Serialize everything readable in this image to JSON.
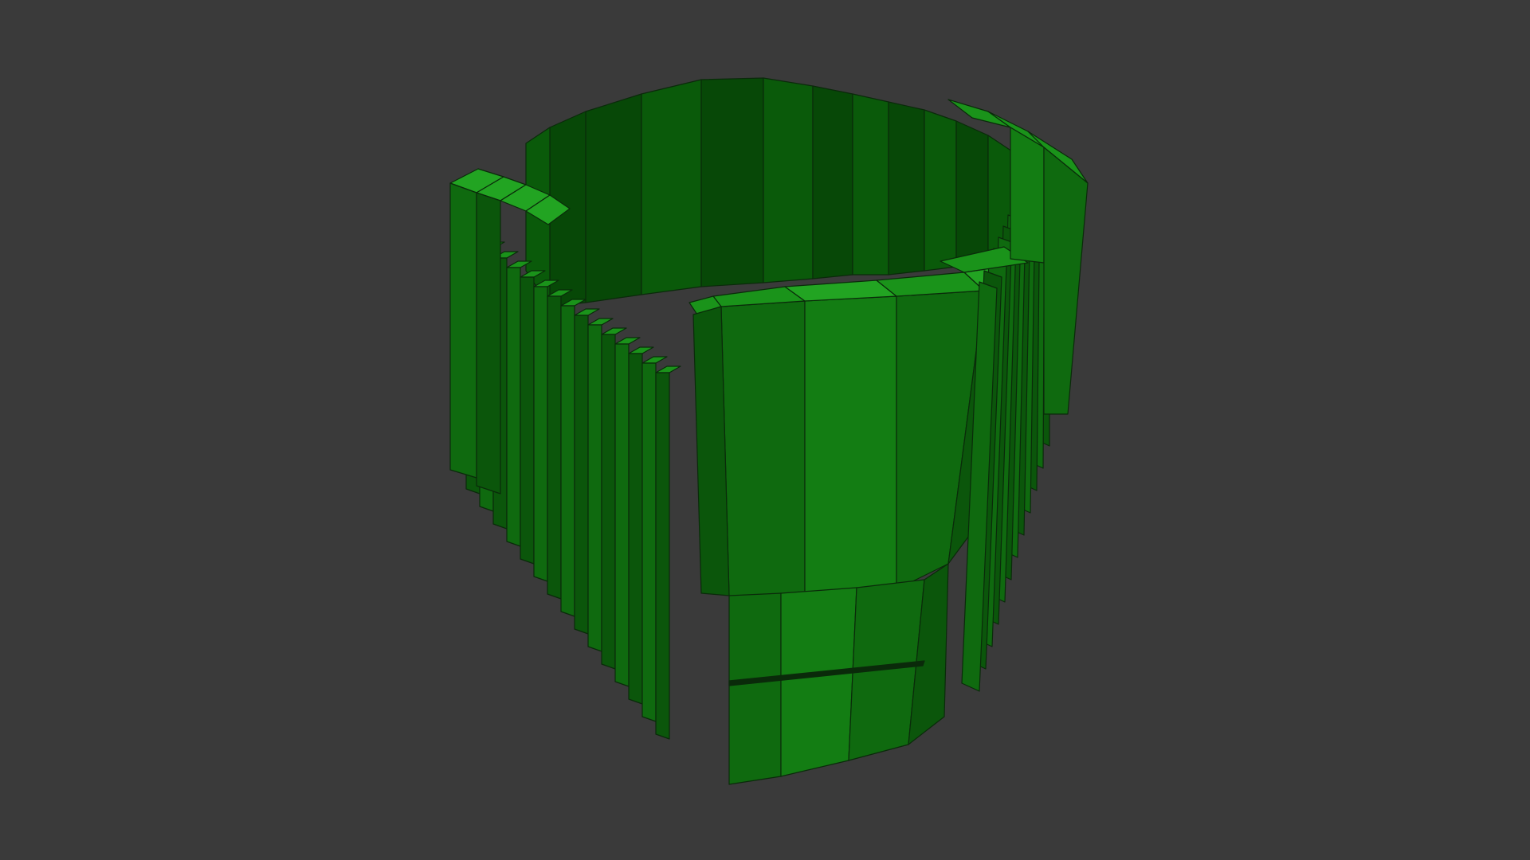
{
  "scene": {
    "background_color": "#3a3a3a",
    "object": "voxel-cup",
    "colors": {
      "outer_lit": "#137d13",
      "outer_mid": "#0f6a0f",
      "outer_dark": "#0b560b",
      "inner_wall": "#0a5a0a",
      "inner_dark": "#074807",
      "rim_top": "#1a931a",
      "rim_top_light": "#22a422",
      "edge": "#0a2a0a"
    }
  }
}
